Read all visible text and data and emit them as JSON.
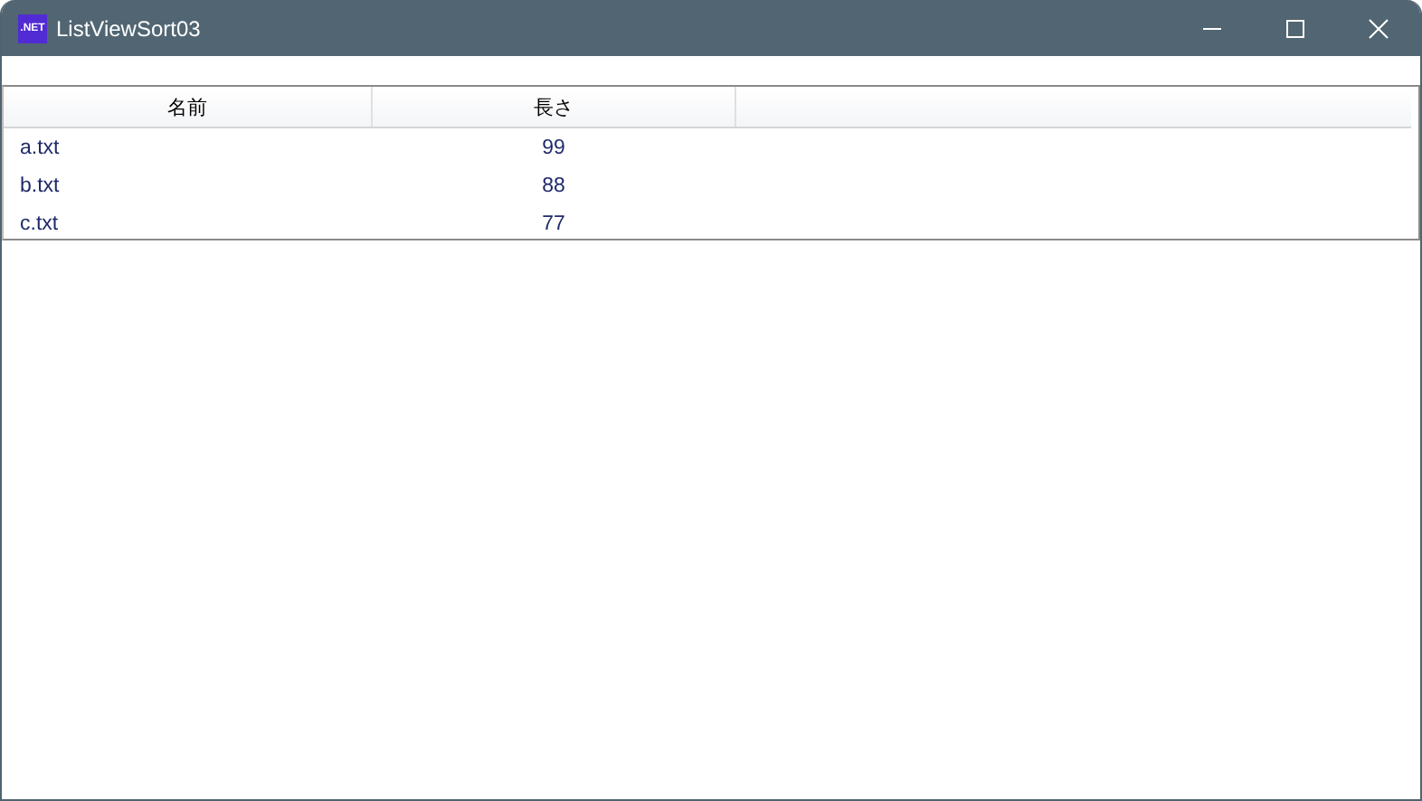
{
  "window": {
    "title": "ListViewSort03",
    "icon_text": ".NET"
  },
  "table": {
    "columns": [
      "名前",
      "長さ"
    ],
    "rows": [
      {
        "cells": [
          "a.txt",
          "99"
        ]
      },
      {
        "cells": [
          "b.txt",
          "88"
        ]
      },
      {
        "cells": [
          "c.txt",
          "77"
        ]
      }
    ]
  }
}
